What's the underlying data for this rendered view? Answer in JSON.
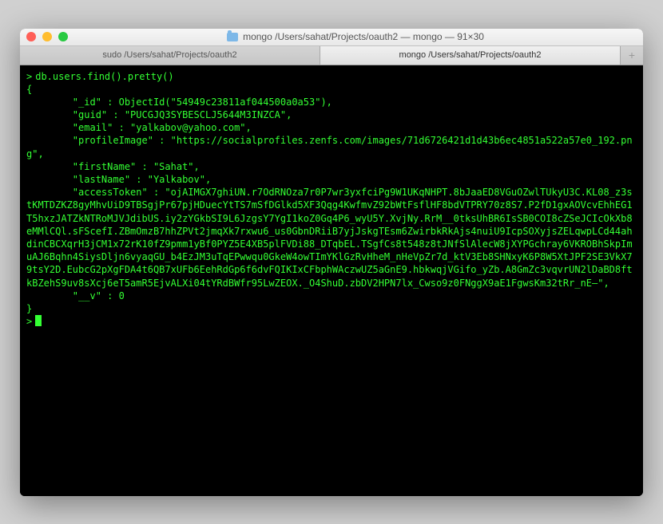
{
  "window": {
    "title": "mongo  /Users/sahat/Projects/oauth2 — mongo — 91×30"
  },
  "tabs": {
    "tab1": "sudo  /Users/sahat/Projects/oauth2",
    "tab2": "mongo  /Users/sahat/Projects/oauth2"
  },
  "terminal": {
    "prompt": ">",
    "command": "db.users.find().pretty()",
    "output": "{\n        \"_id\" : ObjectId(\"54949c23811af044500a0a53\"),\n        \"guid\" : \"PUCGJQ3SYBESCLJ5644M3INZCA\",\n        \"email\" : \"yalkabov@yahoo.com\",\n        \"profileImage\" : \"https://socialprofiles.zenfs.com/images/71d6726421d1d43b6ec4851a522a57e0_192.png\",\n        \"firstName\" : \"Sahat\",\n        \"lastName\" : \"Yalkabov\",\n        \"accessToken\" : \"ojAIMGX7ghiUN.r7OdRNOza7r0P7wr3yxfciPg9W1UKqNHPT.8bJaaED8VGuOZwlTUkyU3C.KL08_z3stKMTDZKZ8gyMhvUiD9TBSgjPr67pjHDuecYtTS7mSfDGlkd5XF3Qqg4KwfmvZ92bWtFsflHF8bdVTPRY70z8S7.P2fD1gxAOVcvEhhEG1T5hxzJATZkNTRoMJVJdibUS.iy2zYGkbSI9L6JzgsY7YgI1koZ0Gq4P6_wyU5Y.XvjNy.RrM__0tksUhBR6IsSB0COI8cZSeJCIcOkXb8eMMlCQl.sFScefI.ZBmOmzB7hhZPVt2jmqXk7rxwu6_us0GbnDRiiB7yjJskgTEsm6ZwirbkRkAjs4nuiU9IcpSOXyjsZELqwpLCd44ahdinCBCXqrH3jCM1x72rK10fZ9pmm1yBf0PYZ5E4XB5plFVDi88_DTqbEL.TSgfCs8t548z8tJNfSlAlecW8jXYPGchray6VKROBhSkpImuAJ6Bqhn4SiysDljn6vyaqGU_b4EzJM3uTqEPwwqu0GkeW4owTImYKlGzRvHheM_nHeVpZr7d_ktV3Eb8SHNxyK6P8W5XtJPF2SE3VkX79tsY2D.EubcG2pXgFDA4t6QB7xUFb6EehRdGp6f6dvFQIKIxCFbphWAczwUZ5aGnE9.hbkwqjVGifo_yZb.A8GmZc3vqvrUN2lDaBD8ftkBZehS9uv8sXcj6eT5amR5EjvALXi04tYRdBWfr95LwZEOX._O4ShuD.zbDV2HPN7lx_Cwso9z0FNggX9aE1FgwsKm32tRr_nE–\",\n        \"__v\" : 0\n}"
  }
}
